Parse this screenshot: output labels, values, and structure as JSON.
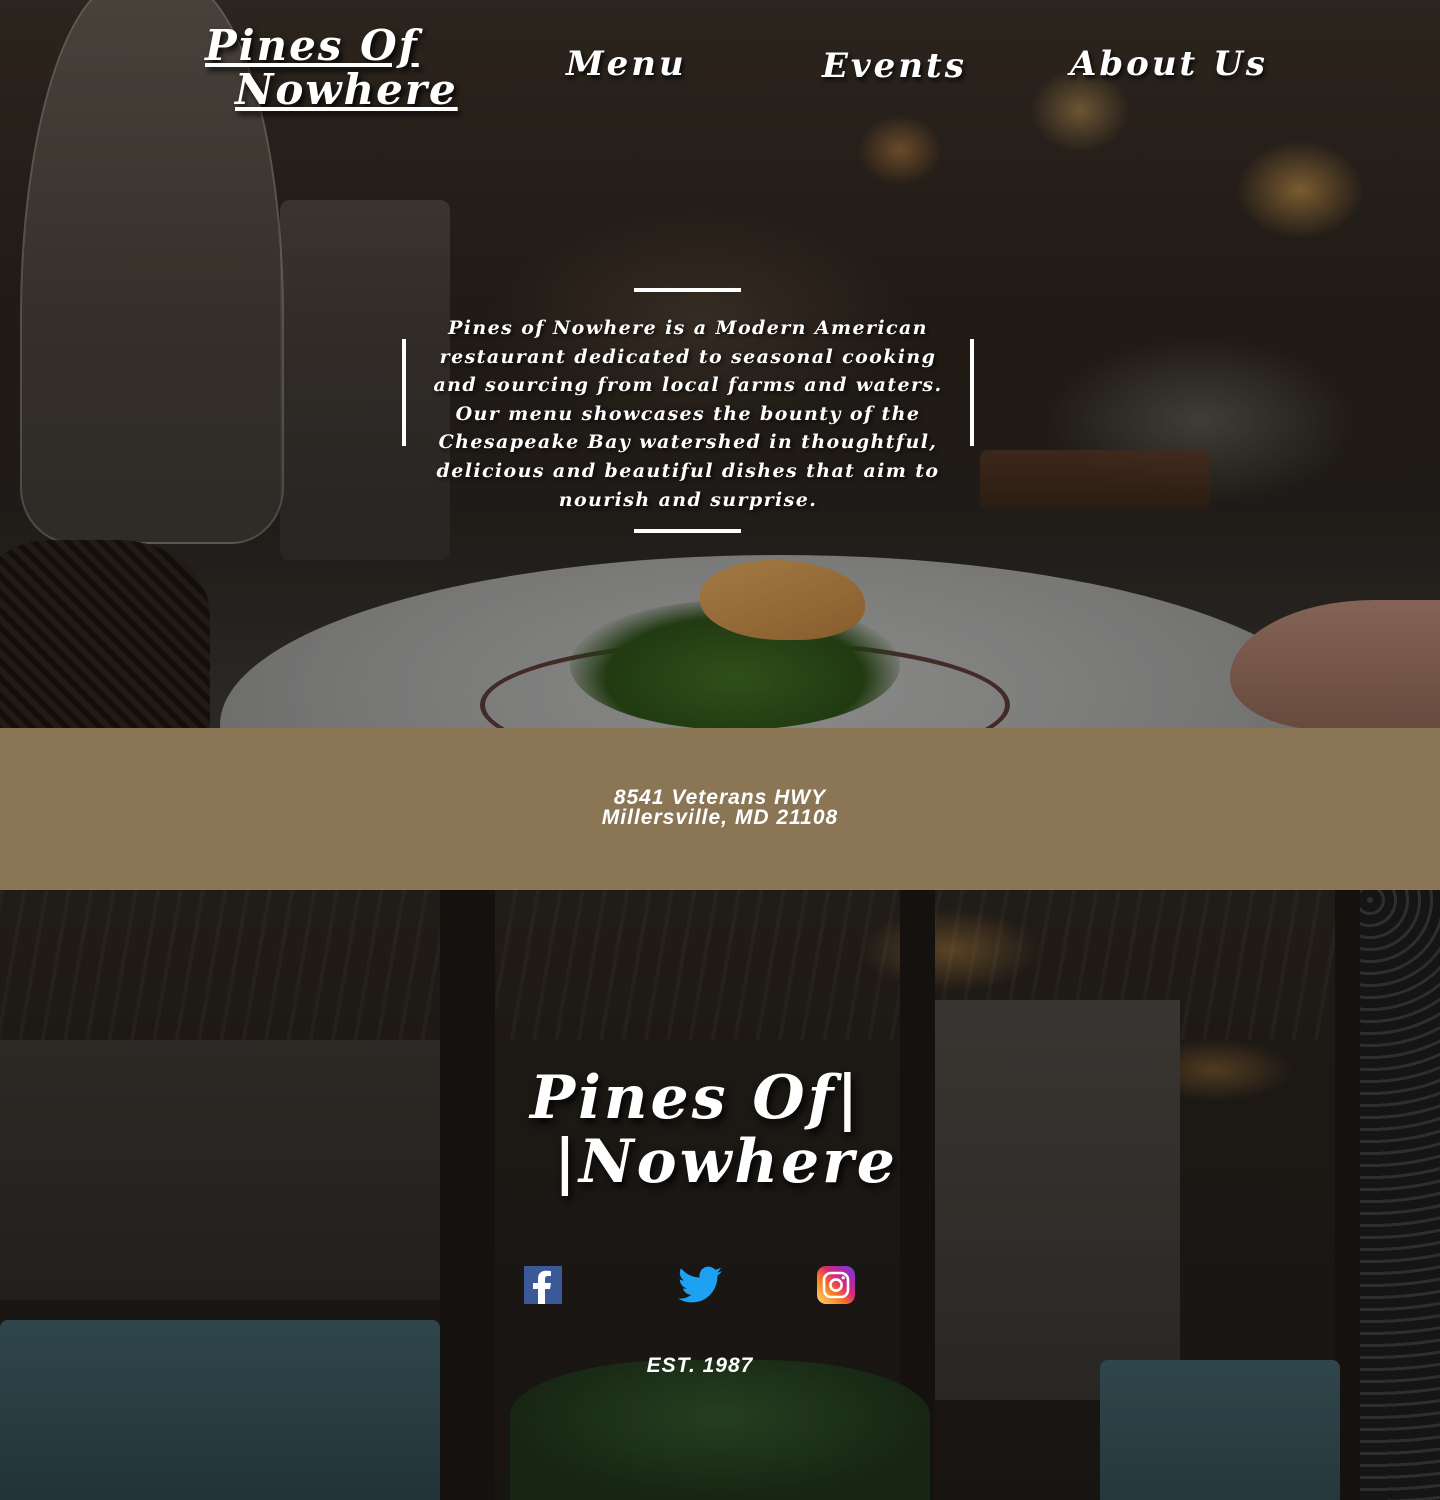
{
  "header": {
    "logo_line1": "Pines Of",
    "logo_line2": "Nowhere",
    "nav": [
      {
        "label": "Menu"
      },
      {
        "label": "Events"
      },
      {
        "label": "About Us"
      }
    ]
  },
  "hero": {
    "blurb": "Pines of  Nowhere is a Modern American restaurant dedicated to seasonal cooking and sourcing from local farms and waters. Our menu showcases the bounty of  the Chesapeake Bay watershed in thoughtful, delicious and beautiful dishes that aim to nourish and surprise."
  },
  "address": {
    "line1": "8541 Veterans HWY",
    "line2": "Millersville, MD 21108"
  },
  "footer": {
    "logo_line1": "Pines Of|",
    "logo_line2": "|Nowhere",
    "social": [
      {
        "icon": "facebook-icon"
      },
      {
        "icon": "twitter-icon"
      },
      {
        "icon": "instagram-icon"
      }
    ],
    "established": "EST. 1987"
  },
  "colors": {
    "band": "#8a7655",
    "text": "#ffffff",
    "facebook": "#3b5998",
    "twitter": "#1da1f2"
  }
}
